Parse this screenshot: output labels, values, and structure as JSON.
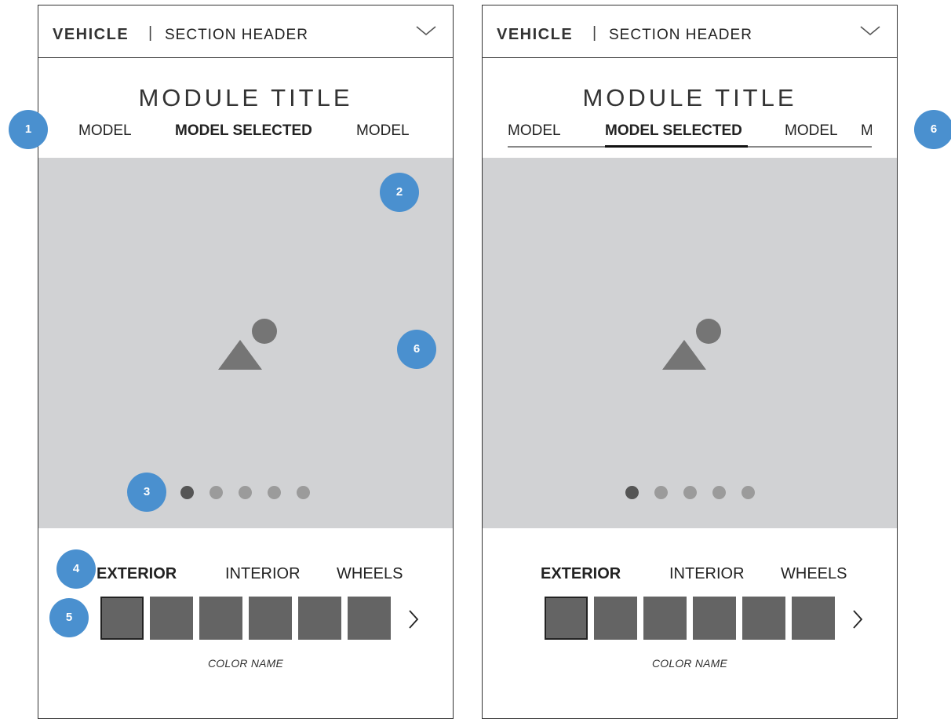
{
  "accent_color": "#4a90cf",
  "panels": [
    {
      "header": {
        "brand": "VEHICLE",
        "separator": "|",
        "section": "SECTION HEADER",
        "icon": "chevron-down-icon"
      },
      "module_title": "MODULE TITLE",
      "model_tabs": [
        "MODEL",
        "MODEL SELECTED",
        "MODEL"
      ],
      "selected_model_index": 1,
      "image_icon": "image-placeholder-icon",
      "carousel": {
        "total": 5,
        "active_index": 0
      },
      "view_tabs": [
        "EXTERIOR",
        "INTERIOR",
        "WHEELS"
      ],
      "selected_view_index": 0,
      "swatch_count": 6,
      "selected_swatch_index": 0,
      "next_icon": "chevron-right-icon",
      "color_name": "COLOR NAME"
    },
    {
      "header": {
        "brand": "VEHICLE",
        "separator": "|",
        "section": "SECTION HEADER",
        "icon": "chevron-down-icon"
      },
      "module_title": "MODULE TITLE",
      "model_tabs": [
        "MODEL",
        "MODEL SELECTED",
        "MODEL",
        "MODEL"
      ],
      "selected_model_index": 1,
      "image_icon": "image-placeholder-icon",
      "carousel": {
        "total": 5,
        "active_index": 0
      },
      "view_tabs": [
        "EXTERIOR",
        "INTERIOR",
        "WHEELS"
      ],
      "selected_view_index": 0,
      "swatch_count": 6,
      "selected_swatch_index": 0,
      "next_icon": "chevron-right-icon",
      "color_name": "COLOR NAME"
    }
  ],
  "annotations": {
    "model_tabs": "1",
    "image": "2",
    "carousel_dots": "3",
    "view_tabs": "4",
    "swatches": "5",
    "swipe": "6",
    "tabs_scroll": "6"
  }
}
